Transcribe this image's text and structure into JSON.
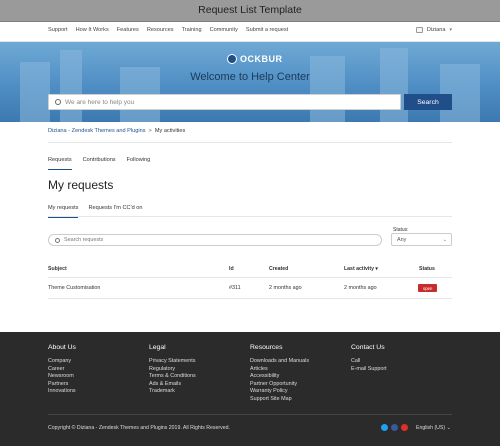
{
  "header": {
    "title": "Request List Template"
  },
  "nav": {
    "items": [
      "Support",
      "How It Works",
      "Features",
      "Resources",
      "Training",
      "Community",
      "Submit a request"
    ],
    "user": "Diziana"
  },
  "hero": {
    "logo": "OCKBUR",
    "welcome": "Welcome to Help Center",
    "search_placeholder": "We are here to help you",
    "search_button": "Search"
  },
  "breadcrumb": {
    "parent": "Diziana - Zendesk Themes and Plugins",
    "sep": ">",
    "current": "My activities"
  },
  "activity_tabs": [
    "Requests",
    "Contributions",
    "Following"
  ],
  "page_title": "My requests",
  "request_tabs": [
    "My requests",
    "Requests I'm CC'd on"
  ],
  "filter": {
    "search_placeholder": "Search requests",
    "status_label": "Status:",
    "status_value": "Any"
  },
  "table": {
    "headers": [
      "Subject",
      "Id",
      "Created",
      "Last activity ▾",
      "Status"
    ],
    "rows": [
      {
        "subject": "Theme Customisation",
        "id": "#311",
        "created": "2 months ago",
        "last_activity": "2 months ago",
        "status": "open"
      }
    ]
  },
  "footer": {
    "columns": [
      {
        "title": "About Us",
        "items": [
          "Company",
          "Career",
          "Newsroom",
          "Partners",
          "Innovations"
        ]
      },
      {
        "title": "Legal",
        "items": [
          "Privacy Statements",
          "Regulatory",
          "Terms & Conditions",
          "Ads & Emails",
          "Trademark"
        ]
      },
      {
        "title": "Resources",
        "items": [
          "Downloads and Manuals",
          "Articles",
          "Accessibility",
          "Partner Opportunity",
          "Warranty Policy",
          "Support Site Map"
        ]
      },
      {
        "title": "Contact Us",
        "items": [
          "Call",
          "E-mail Support"
        ]
      }
    ],
    "copyright": "Copyright © Diziana - Zendesk Themes and Plugins 2019. All Rights Reserved.",
    "social_icons": [
      "twitter-icon",
      "facebook-icon",
      "youtube-icon"
    ],
    "language": "English (US)"
  },
  "colors": {
    "accent": "#1f4e8a",
    "badge": "#c92b2b",
    "footer_bg": "#2b2b2b"
  }
}
